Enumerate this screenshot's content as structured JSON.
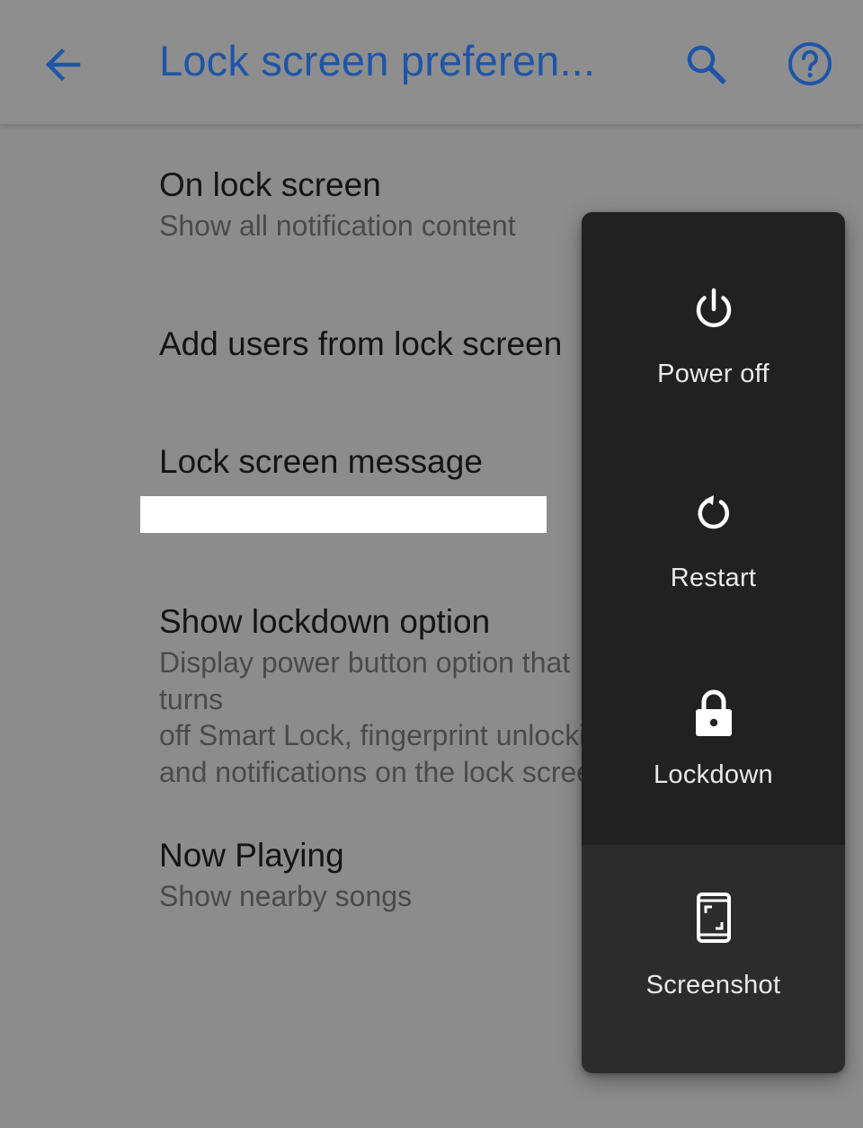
{
  "app_bar": {
    "title": "Lock screen preferen...",
    "back_icon": "arrow-back-icon",
    "search_icon": "search-icon",
    "help_icon": "help-circle-icon",
    "accent_color": "#1f55a8"
  },
  "settings": [
    {
      "title": "On lock screen",
      "subtitle": "Show all notification content"
    },
    {
      "title": "Add users from lock screen",
      "subtitle": ""
    },
    {
      "title": "Lock screen message",
      "subtitle": ""
    },
    {
      "title": "Show lockdown option",
      "subtitle": "Display power button option that turns\noff Smart Lock, fingerprint unlocking,\nand notifications on the lock screen"
    },
    {
      "title": "Now Playing",
      "subtitle": "Show nearby songs"
    }
  ],
  "power_menu": {
    "items": [
      {
        "label": "Power off",
        "icon": "power-icon"
      },
      {
        "label": "Restart",
        "icon": "restart-icon"
      },
      {
        "label": "Lockdown",
        "icon": "lock-icon"
      },
      {
        "label": "Screenshot",
        "icon": "screenshot-icon"
      }
    ],
    "colors": {
      "primary": "#212121",
      "secondary": "#2c2c2c"
    }
  }
}
